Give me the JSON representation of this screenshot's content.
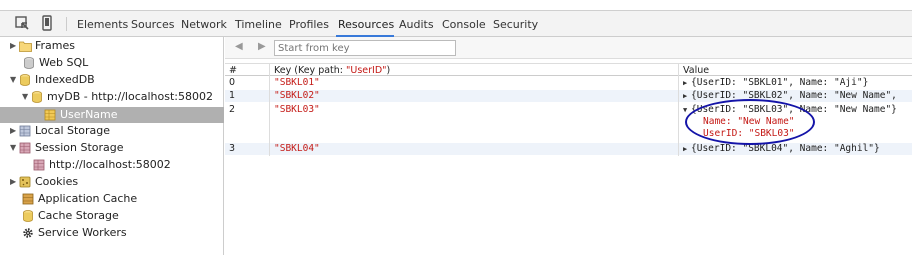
{
  "toolbar": {
    "tabs": [
      "Elements",
      "Sources",
      "Network",
      "Timeline",
      "Profiles",
      "Resources",
      "Audits",
      "Console",
      "Security"
    ],
    "active_tab": "Resources"
  },
  "sidebar": {
    "items": [
      {
        "label": "Frames"
      },
      {
        "label": "Web SQL"
      },
      {
        "label": "IndexedDB"
      },
      {
        "label": "myDB - http://localhost:58002"
      },
      {
        "label": "UserName"
      },
      {
        "label": "Local Storage"
      },
      {
        "label": "Session Storage"
      },
      {
        "label": "http://localhost:58002"
      },
      {
        "label": "Cookies"
      },
      {
        "label": "Application Cache"
      },
      {
        "label": "Cache Storage"
      },
      {
        "label": "Service Workers"
      }
    ]
  },
  "filter": {
    "placeholder": "Start from key"
  },
  "grid": {
    "col_index": "#",
    "col_key_prefix": "Key (Key path: ",
    "col_key_path": "\"UserID\"",
    "col_key_suffix": ")",
    "col_value": "Value",
    "rows": [
      {
        "index": "0",
        "key": "\"SBKL01\"",
        "value": "{UserID: \"SBKL01\", Name: \"Aji\"}"
      },
      {
        "index": "1",
        "key": "\"SBKL02\"",
        "value": "{UserID: \"SBKL02\", Name: \"New Name\","
      },
      {
        "index": "2",
        "key": "\"SBKL03\"",
        "value": "{UserID: \"SBKL03\", Name: \"New Name\"}",
        "children": [
          "Name: \"New Name\"",
          "UserID: \"SBKL03\""
        ]
      },
      {
        "index": "3",
        "key": "\"SBKL04\"",
        "value": "{UserID: \"SBKL04\", Name: \"Aghil\"}"
      }
    ]
  },
  "colors": {
    "accent": "#3879d9",
    "selection": "#b0b0b0",
    "key_text": "#c41a16",
    "annotation": "#1414a8"
  }
}
